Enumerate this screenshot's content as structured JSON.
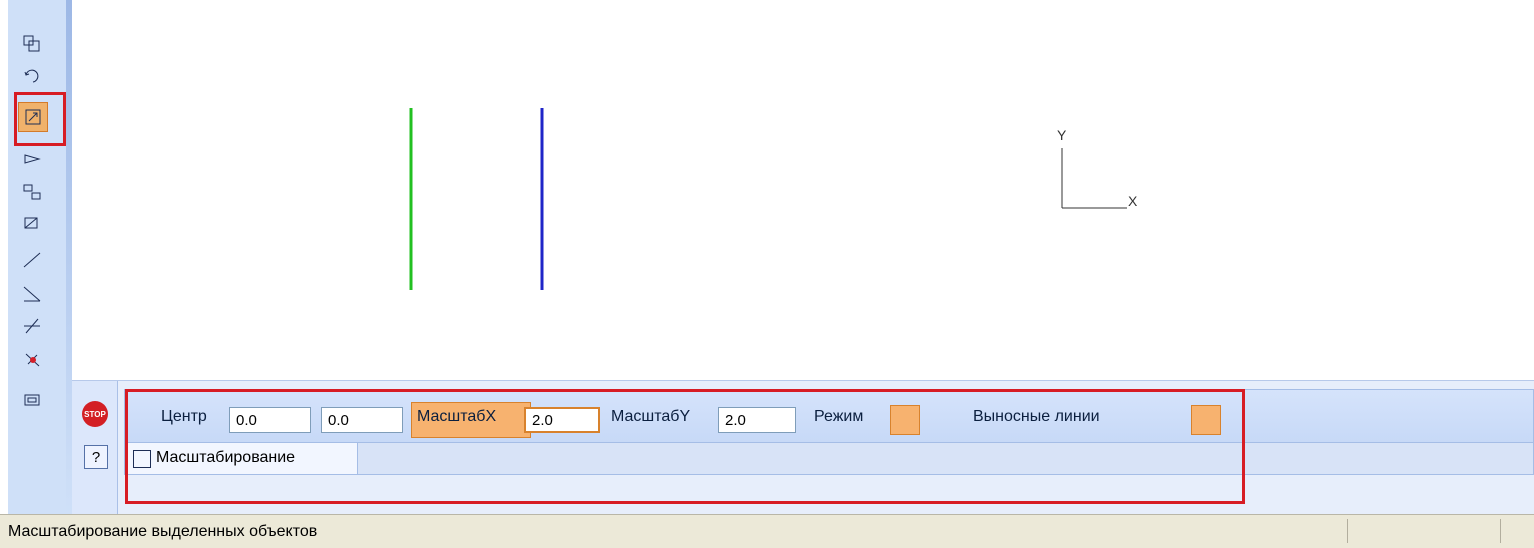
{
  "left_toolbar": {
    "tools": [
      {
        "icon": "copy-transform-icon",
        "active": false
      },
      {
        "icon": "rotate-icon",
        "active": false
      },
      {
        "icon": "scale-icon",
        "active": true
      },
      {
        "icon": "mirror-icon",
        "active": false
      },
      {
        "icon": "array-copy-icon",
        "active": false
      },
      {
        "icon": "deform-icon",
        "active": false
      },
      {
        "icon": "break-curve-icon",
        "active": false
      },
      {
        "icon": "trim-icon",
        "active": false
      },
      {
        "icon": "split-icon",
        "active": false
      },
      {
        "icon": "delete-part-icon",
        "active": false
      },
      {
        "icon": "equidistant-icon",
        "active": false
      }
    ]
  },
  "canvas": {
    "axis_y_label": "Y",
    "axis_x_label": "X",
    "segment_colors": [
      "#22c021",
      "#1f25c8"
    ]
  },
  "property_panel": {
    "center_label": "Центр",
    "center_x": "0.0",
    "center_y": "0.0",
    "scale_x_label": "МасштабX",
    "scale_x_value": "2.0",
    "scale_y_label": "МасштабY",
    "scale_y_value": "2.0",
    "mode_label": "Режим",
    "extension_lines_label": "Выносные линии",
    "tab_label": "Масштабирование",
    "stop_label": "STOP",
    "help_label": "?"
  },
  "status_bar": {
    "text": "Масштабирование выделенных объектов"
  },
  "highlight_color": "#d71c24"
}
